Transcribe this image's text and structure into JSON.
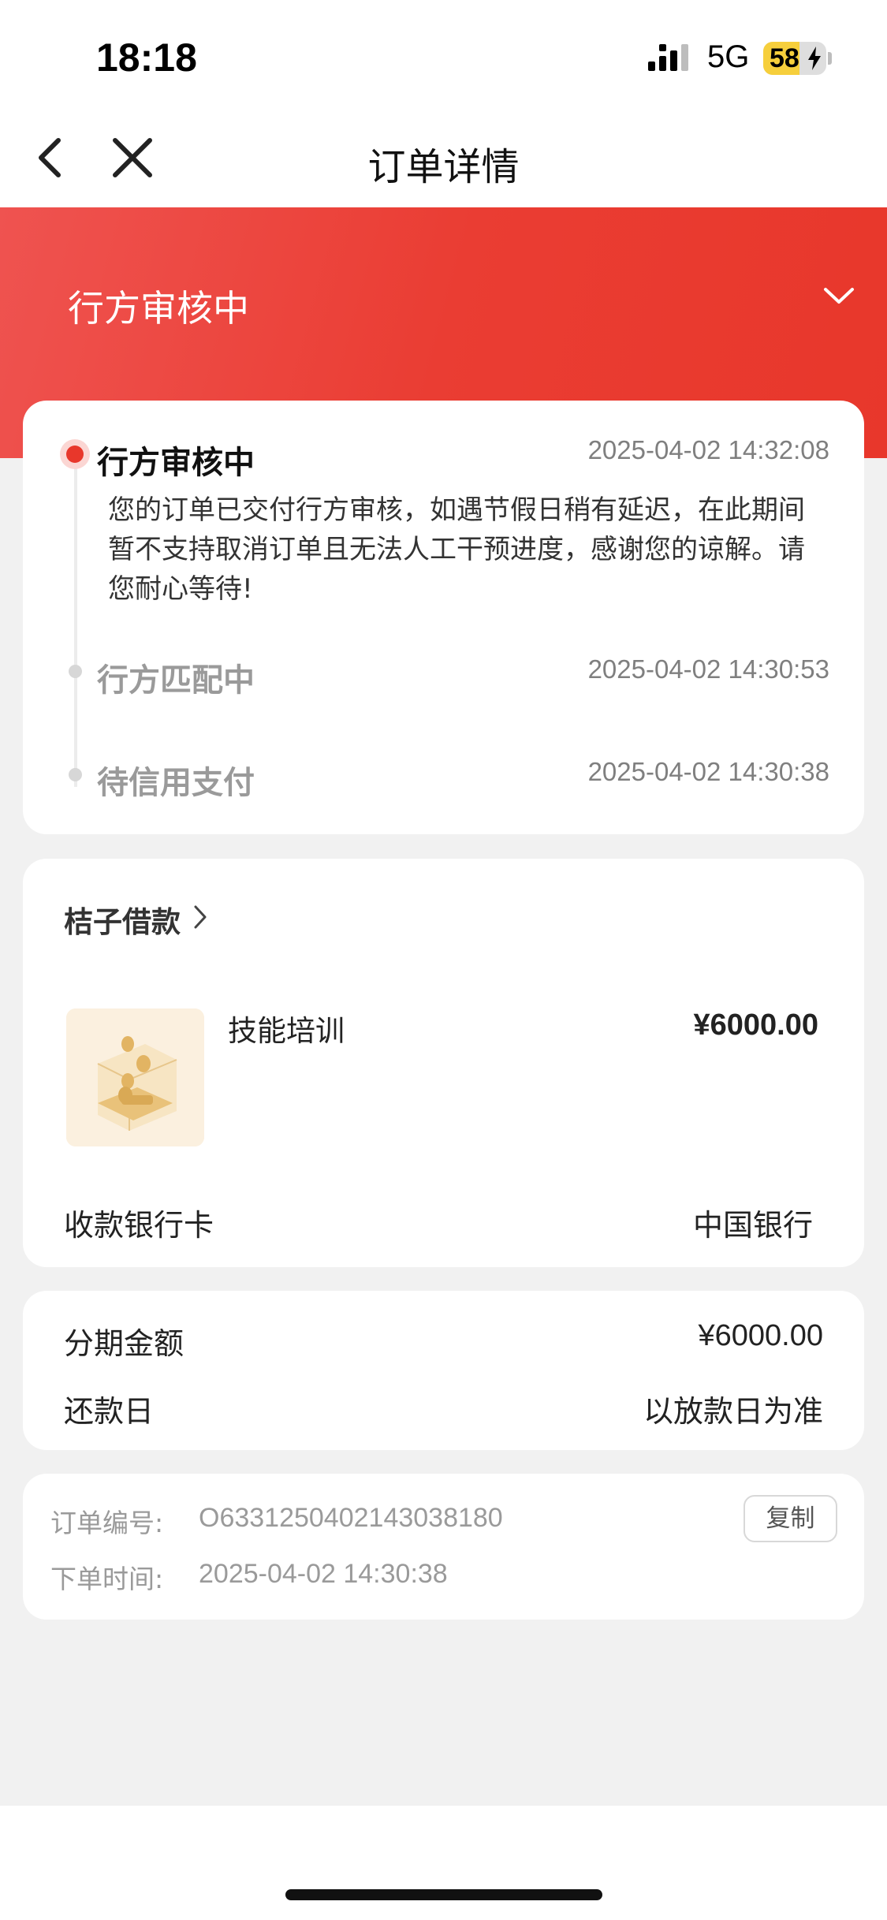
{
  "status_bar": {
    "time": "18:18",
    "network": "5G",
    "battery_percent": "58",
    "battery_level": 0.58,
    "charging": true
  },
  "nav": {
    "title": "订单详情",
    "back_icon": "chevron-left-icon",
    "close_icon": "close-icon"
  },
  "banner": {
    "status_title": "行方审核中",
    "expand_icon": "chevron-down-icon"
  },
  "progress": {
    "steps": [
      {
        "label": "行方审核中",
        "time": "2025-04-02 14:32:08",
        "active": true,
        "desc_lines": [
          "您的订单已交付行方审核，如遇节假日稍有延迟，在此期间",
          "暂不支持取消订单且无法人工干预进度，感谢您的谅解。请",
          "您耐心等待!"
        ]
      },
      {
        "label": "行方匹配中",
        "time": "2025-04-02 14:30:53",
        "active": false
      },
      {
        "label": "待信用支付",
        "time": "2025-04-02 14:30:38",
        "active": false
      }
    ]
  },
  "product": {
    "merchant": "桔子借款",
    "merchant_icon": "chevron-right-icon",
    "name": "技能培训",
    "price": "¥6000.00",
    "bank_label": "收款银行卡",
    "bank_value": "中国银行"
  },
  "installment": {
    "amount_label": "分期金额",
    "amount_value": "¥6000.00",
    "repay_label": "还款日",
    "repay_value": "以放款日为准"
  },
  "order": {
    "number_label": "订单编号:",
    "number_value": "O6331250402143038180",
    "time_label": "下单时间:",
    "time_value": "2025-04-02 14:30:38",
    "copy_label": "复制"
  },
  "colors": {
    "brand_red": "#e8372b",
    "background": "#f1f1f1",
    "muted_text": "#9a9a9a"
  }
}
